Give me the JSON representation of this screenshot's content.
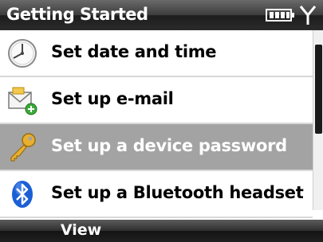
{
  "titlebar": {
    "title": "Getting Started"
  },
  "status": {
    "battery_icon": "battery-icon",
    "signal_icon": "signal-icon"
  },
  "items": [
    {
      "label": "Set date and time",
      "icon": "clock-icon",
      "selected": false
    },
    {
      "label": "Set up e-mail",
      "icon": "email-icon",
      "selected": false
    },
    {
      "label": "Set up a device password",
      "icon": "key-icon",
      "selected": true
    },
    {
      "label": "Set up a Bluetooth headset",
      "icon": "bluetooth-icon",
      "selected": false
    }
  ],
  "softkeys": {
    "left": "View"
  },
  "colors": {
    "selection": "#a3a3a3",
    "bluetooth": "#1b5fd6"
  }
}
